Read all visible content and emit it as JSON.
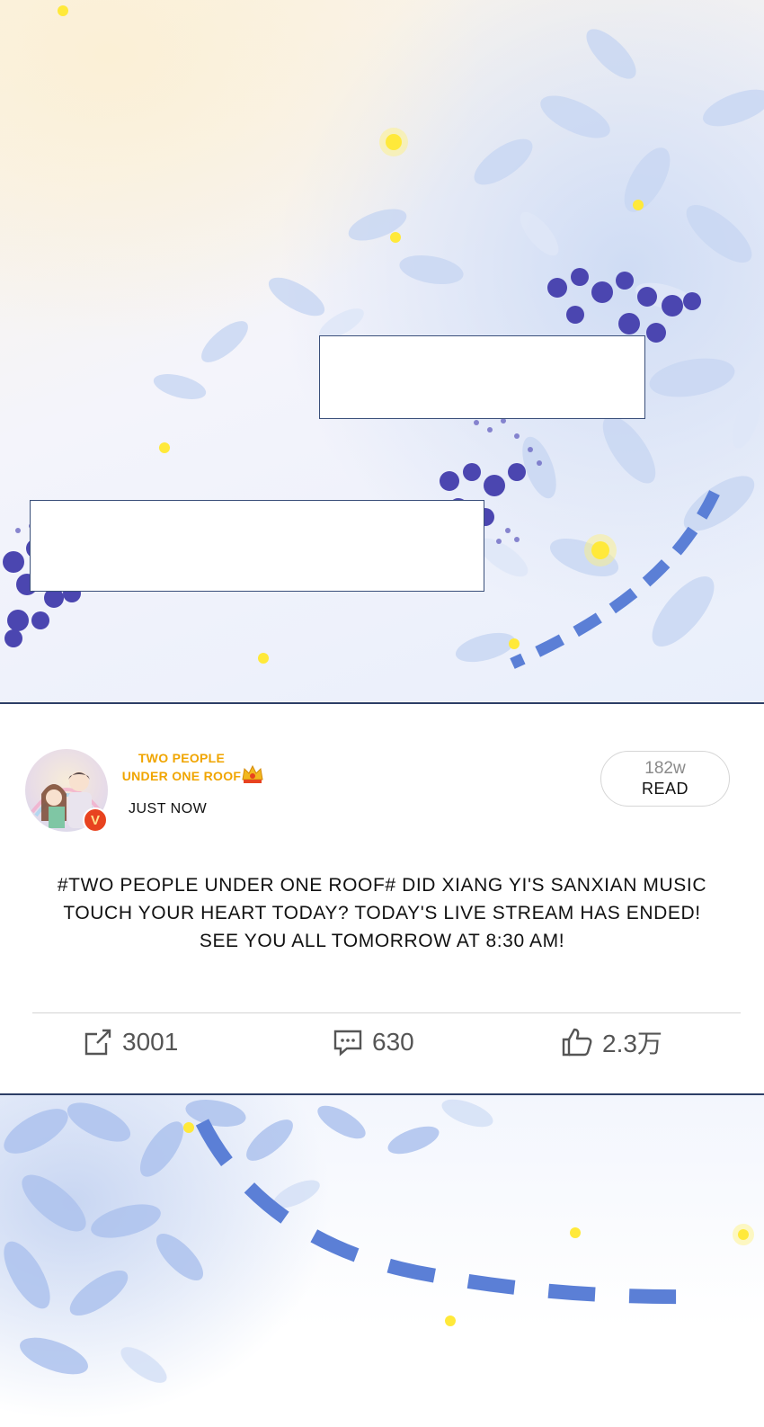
{
  "post": {
    "account_name": "TWO PEOPLE UNDER ONE ROOF",
    "verified_badge": "V",
    "timestamp": "JUST NOW",
    "read_count": "182w",
    "read_label": "READ",
    "text": "#TWO PEOPLE UNDER ONE ROOF# DID XIANG YI'S SANXIAN MUSIC TOUCH YOUR HEART TODAY? TODAY'S LIVE STREAM HAS ENDED! SEE YOU ALL TOMORROW AT 8:30 AM!"
  },
  "actions": {
    "share": {
      "icon": "share-icon",
      "count": "3001"
    },
    "comment": {
      "icon": "comment-icon",
      "count": "630"
    },
    "like": {
      "icon": "thumbs-up-icon",
      "count": "2.3万"
    }
  },
  "colors": {
    "username": "#f0a500",
    "badge": "#e8431f",
    "frame": "#2c3e66",
    "flowers": "#4b46b0",
    "ribbon": "#5b7fd6"
  }
}
